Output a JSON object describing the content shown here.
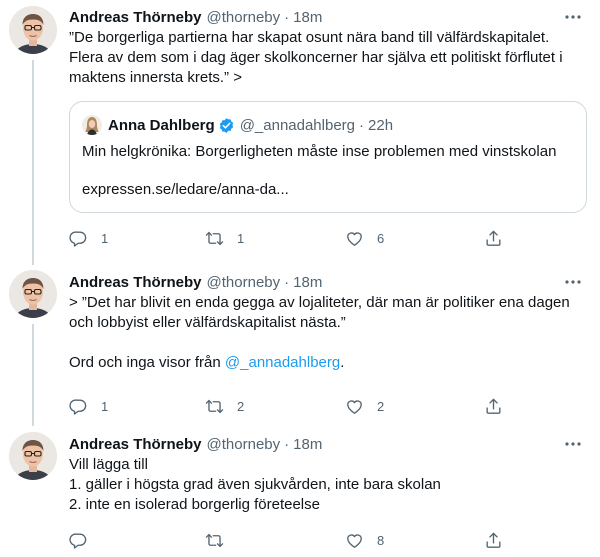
{
  "tweets": [
    {
      "name": "Andreas Thörneby",
      "handle": "@thorneby",
      "separator": "·",
      "time": "18m",
      "text": "”De borgerliga partierna har skapat osunt nära band till välfärdskapitalet. Flera av dem som i dag äger skolkoncerner har själva ett politiskt förflutet i maktens innersta krets.” >",
      "quote": {
        "name": "Anna Dahlberg",
        "handle": "@_annadahlberg",
        "separator": "·",
        "time": "22h",
        "text": "Min helgkrönika: Borgerligheten måste inse problemen med vinstskolan",
        "link": "expressen.se/ledare/anna-da..."
      },
      "replies": "1",
      "retweets": "1",
      "likes": "6"
    },
    {
      "name": "Andreas Thörneby",
      "handle": "@thorneby",
      "separator": "·",
      "time": "18m",
      "text": "> ”Det har blivit en enda gegga av lojaliteter, där man är politiker ena dagen och lobbyist eller välfärdskapitalist nästa.”",
      "text2_prefix": "Ord och inga visor från ",
      "text2_link": "@_annadahlberg",
      "text2_suffix": ".",
      "replies": "1",
      "retweets": "2",
      "likes": "2"
    },
    {
      "name": "Andreas Thörneby",
      "handle": "@thorneby",
      "separator": "·",
      "time": "18m",
      "text": "Vill lägga till\n1. gäller i högsta grad även sjukvården, inte bara skolan\n2. inte en isolerad borgerlig företeelse",
      "replies": "",
      "retweets": "",
      "likes": "8"
    }
  ],
  "icons": {
    "reply": "reply-icon",
    "retweet": "retweet-icon",
    "like": "heart-icon",
    "share": "share-icon",
    "more": "more-icon",
    "verified": "verified-badge-icon"
  },
  "colors": {
    "text": "#0f1419",
    "secondary": "#536471",
    "link": "#1d9bf0",
    "border": "#cfd9de"
  }
}
